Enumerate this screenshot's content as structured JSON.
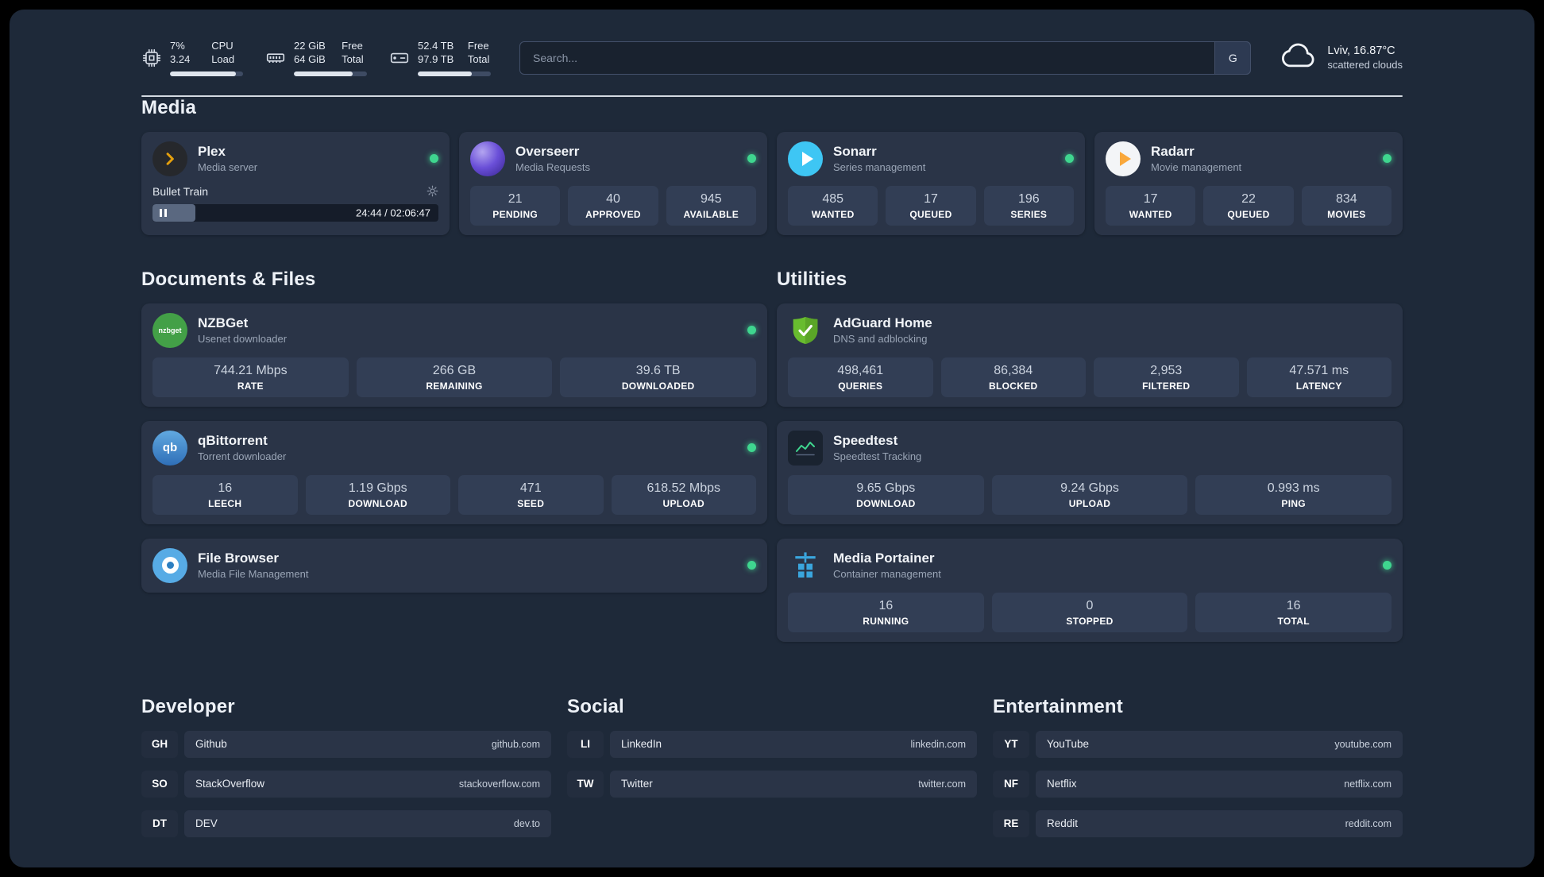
{
  "topbar": {
    "cpu": {
      "value": "7%",
      "load": "3.24",
      "unit_label": "CPU",
      "sub_label": "Load",
      "bar": "90%"
    },
    "memory": {
      "free": "22 GiB",
      "total": "64 GiB",
      "unit_label": "Free",
      "sub_label": "Total",
      "bar": "80%"
    },
    "disk": {
      "free": "52.4 TB",
      "total": "97.9 TB",
      "unit_label": "Free",
      "sub_label": "Total",
      "bar": "74%"
    },
    "search": {
      "placeholder": "Search...",
      "provider": "G"
    },
    "weather": {
      "location": "Lviv, 16.87°C",
      "condition": "scattered clouds"
    }
  },
  "media": {
    "title": "Media",
    "plex": {
      "name": "Plex",
      "desc": "Media server",
      "now_playing": "Bullet Train",
      "time": "24:44 / 02:06:47",
      "progress": "15%"
    },
    "overseerr": {
      "name": "Overseerr",
      "desc": "Media Requests",
      "stats": [
        {
          "value": "21",
          "label": "PENDING"
        },
        {
          "value": "40",
          "label": "APPROVED"
        },
        {
          "value": "945",
          "label": "AVAILABLE"
        }
      ]
    },
    "sonarr": {
      "name": "Sonarr",
      "desc": "Series management",
      "stats": [
        {
          "value": "485",
          "label": "WANTED"
        },
        {
          "value": "17",
          "label": "QUEUED"
        },
        {
          "value": "196",
          "label": "SERIES"
        }
      ]
    },
    "radarr": {
      "name": "Radarr",
      "desc": "Movie management",
      "stats": [
        {
          "value": "17",
          "label": "WANTED"
        },
        {
          "value": "22",
          "label": "QUEUED"
        },
        {
          "value": "834",
          "label": "MOVIES"
        }
      ]
    }
  },
  "documents": {
    "title": "Documents & Files",
    "nzbget": {
      "name": "NZBGet",
      "desc": "Usenet downloader",
      "icon_text": "nzbget",
      "stats": [
        {
          "value": "744.21 Mbps",
          "label": "RATE"
        },
        {
          "value": "266 GB",
          "label": "REMAINING"
        },
        {
          "value": "39.6 TB",
          "label": "DOWNLOADED"
        }
      ]
    },
    "qbittorrent": {
      "name": "qBittorrent",
      "desc": "Torrent downloader",
      "icon_text": "qb",
      "stats": [
        {
          "value": "16",
          "label": "LEECH"
        },
        {
          "value": "1.19 Gbps",
          "label": "DOWNLOAD"
        },
        {
          "value": "471",
          "label": "SEED"
        },
        {
          "value": "618.52 Mbps",
          "label": "UPLOAD"
        }
      ]
    },
    "filebrowser": {
      "name": "File Browser",
      "desc": "Media File Management"
    }
  },
  "utilities": {
    "title": "Utilities",
    "adguard": {
      "name": "AdGuard Home",
      "desc": "DNS and adblocking",
      "stats": [
        {
          "value": "498,461",
          "label": "QUERIES"
        },
        {
          "value": "86,384",
          "label": "BLOCKED"
        },
        {
          "value": "2,953",
          "label": "FILTERED"
        },
        {
          "value": "47.571 ms",
          "label": "LATENCY"
        }
      ]
    },
    "speedtest": {
      "name": "Speedtest",
      "desc": "Speedtest Tracking",
      "stats": [
        {
          "value": "9.65 Gbps",
          "label": "DOWNLOAD"
        },
        {
          "value": "9.24 Gbps",
          "label": "UPLOAD"
        },
        {
          "value": "0.993 ms",
          "label": "PING"
        }
      ]
    },
    "portainer": {
      "name": "Media Portainer",
      "desc": "Container management",
      "stats": [
        {
          "value": "16",
          "label": "RUNNING"
        },
        {
          "value": "0",
          "label": "STOPPED"
        },
        {
          "value": "16",
          "label": "TOTAL"
        }
      ]
    }
  },
  "bookmarks": [
    {
      "title": "Developer",
      "items": [
        {
          "abbr": "GH",
          "name": "Github",
          "domain": "github.com"
        },
        {
          "abbr": "SO",
          "name": "StackOverflow",
          "domain": "stackoverflow.com"
        },
        {
          "abbr": "DT",
          "name": "DEV",
          "domain": "dev.to"
        }
      ]
    },
    {
      "title": "Social",
      "items": [
        {
          "abbr": "LI",
          "name": "LinkedIn",
          "domain": "linkedin.com"
        },
        {
          "abbr": "TW",
          "name": "Twitter",
          "domain": "twitter.com"
        }
      ]
    },
    {
      "title": "Entertainment",
      "items": [
        {
          "abbr": "YT",
          "name": "YouTube",
          "domain": "youtube.com"
        },
        {
          "abbr": "NF",
          "name": "Netflix",
          "domain": "netflix.com"
        },
        {
          "abbr": "RE",
          "name": "Reddit",
          "domain": "reddit.com"
        }
      ]
    }
  ],
  "colors": {
    "status_online": "#3fd68f",
    "accent_plex": "#e5a00d"
  }
}
